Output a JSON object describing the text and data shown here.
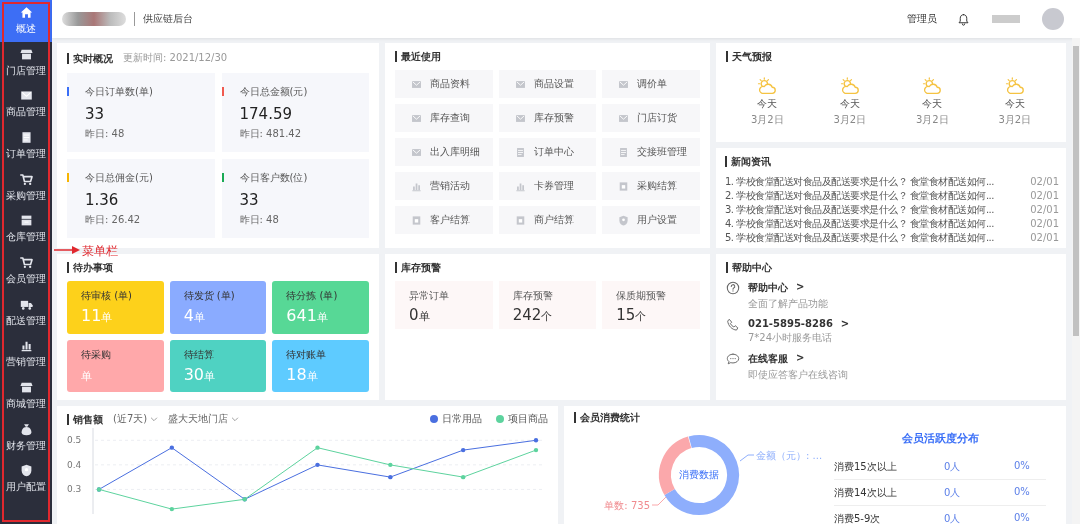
{
  "sidebar": {
    "items": [
      {
        "label": "概述",
        "kind": "home",
        "selected": true
      },
      {
        "label": "门店管理",
        "kind": "store",
        "selected": false
      },
      {
        "label": "商品管理",
        "kind": "tray",
        "selected": false
      },
      {
        "label": "订单管理",
        "kind": "note",
        "selected": false
      },
      {
        "label": "采购管理",
        "kind": "cart",
        "selected": false
      },
      {
        "label": "仓库管理",
        "kind": "archive",
        "selected": false
      },
      {
        "label": "会员管理",
        "kind": "cart",
        "selected": false
      },
      {
        "label": "配送管理",
        "kind": "truck",
        "selected": false
      },
      {
        "label": "营销管理",
        "kind": "bars",
        "selected": false
      },
      {
        "label": "商城管理",
        "kind": "store",
        "selected": false
      },
      {
        "label": "财务管理",
        "kind": "moneybag",
        "selected": false
      },
      {
        "label": "用户配置",
        "kind": "shield",
        "selected": false
      }
    ]
  },
  "annotation": {
    "label": "菜单栏"
  },
  "header": {
    "title": "供应链后台",
    "user_role": "管理员"
  },
  "overview": {
    "title": "实时概况",
    "updated": "更新时间: 2021/12/30",
    "stats": [
      {
        "label": "今日订单数(单)",
        "value": "33",
        "yesterday": "昨日: 48",
        "color": "#3a6ff7"
      },
      {
        "label": "今日总金额(元)",
        "value": "174.59",
        "yesterday": "昨日: 481.42",
        "color": "#f05a4f"
      },
      {
        "label": "今日总佣金(元)",
        "value": "1.36",
        "yesterday": "昨日: 26.42",
        "color": "#f7b500"
      },
      {
        "label": "今日客户数(位)",
        "value": "33",
        "yesterday": "昨日: 48",
        "color": "#1aaa55"
      }
    ]
  },
  "recent": {
    "title": "最近使用",
    "items": [
      {
        "label": "商品资料",
        "kind": "tray"
      },
      {
        "label": "商品设置",
        "kind": "tray"
      },
      {
        "label": "调价单",
        "kind": "tray"
      },
      {
        "label": "库存查询",
        "kind": "tray"
      },
      {
        "label": "库存预警",
        "kind": "tray"
      },
      {
        "label": "门店订货",
        "kind": "tray"
      },
      {
        "label": "出入库明细",
        "kind": "tray"
      },
      {
        "label": "订单中心",
        "kind": "note"
      },
      {
        "label": "交接班管理",
        "kind": "note"
      },
      {
        "label": "营销活动",
        "kind": "bars"
      },
      {
        "label": "卡券管理",
        "kind": "bars"
      },
      {
        "label": "采购结算",
        "kind": "bill"
      },
      {
        "label": "客户结算",
        "kind": "bill"
      },
      {
        "label": "商户结算",
        "kind": "bill"
      },
      {
        "label": "用户设置",
        "kind": "shield"
      }
    ]
  },
  "weather": {
    "title": "天气预报",
    "days": [
      {
        "day": "今天",
        "date": "3月2日"
      },
      {
        "day": "今天",
        "date": "3月2日"
      },
      {
        "day": "今天",
        "date": "3月2日"
      },
      {
        "day": "今天",
        "date": "3月2日"
      }
    ]
  },
  "news": {
    "title": "新闻资讯",
    "items": [
      {
        "text": "1. 学校食堂配送对食品及配送要求是什么？ 食堂食材配送如何...",
        "date": "02/01"
      },
      {
        "text": "2. 学校食堂配送对食品及配送要求是什么？ 食堂食材配送如何...",
        "date": "02/01"
      },
      {
        "text": "3. 学校食堂配送对食品及配送要求是什么？ 食堂食材配送如何...",
        "date": "02/01"
      },
      {
        "text": "4. 学校食堂配送对食品及配送要求是什么？ 食堂食材配送如何...",
        "date": "02/01"
      },
      {
        "text": "5. 学校食堂配送对食品及配送要求是什么？ 食堂食材配送如何...",
        "date": "02/01"
      }
    ]
  },
  "todo": {
    "title": "待办事项",
    "cards": [
      {
        "label": "待审核 (单)",
        "value": "11",
        "unit": "单",
        "color": "#fdd11b"
      },
      {
        "label": "待发货 (单)",
        "value": "4",
        "unit": "单",
        "color": "#8aabff"
      },
      {
        "label": "待分拣 (单)",
        "value": "641",
        "unit": "单",
        "color": "#57d896"
      },
      {
        "label": "待采购",
        "unit": "单",
        "color": "#ffa8aa"
      },
      {
        "label": "待结算",
        "value": "30",
        "unit": "单",
        "color": "#4fd2c2"
      },
      {
        "label": "待对账单",
        "value": "18",
        "unit": "单",
        "color": "#5ecbff"
      }
    ]
  },
  "stock": {
    "title": "库存预警",
    "items": [
      {
        "label": "异常订单",
        "value": "0",
        "unit": "单"
      },
      {
        "label": "库存预警",
        "value": "242",
        "unit": "个"
      },
      {
        "label": "保质期预警",
        "value": "15",
        "unit": "个"
      }
    ]
  },
  "help": {
    "title": "帮助中心",
    "items": [
      {
        "kind": "question",
        "title": "帮助中心",
        "chevron": ">",
        "desc": "全面了解产品功能"
      },
      {
        "kind": "phone",
        "title": "021-5895-8286",
        "chevron": ">",
        "desc": "7*24小时服务电话"
      },
      {
        "kind": "chat",
        "title": "在线客服",
        "chevron": ">",
        "desc": "即使应答客户在线咨询"
      }
    ]
  },
  "sales": {
    "title": "销售额",
    "range": "(近7天)",
    "store": "盛大天地门店",
    "chart_data": {
      "type": "line",
      "grid": true,
      "ylim": [
        0.2,
        0.55
      ],
      "yticks": [
        0.3,
        0.4,
        0.5
      ],
      "series": [
        {
          "name": "日常用品",
          "color": "#4a6fe0",
          "values": [
            0.3,
            0.47,
            0.26,
            0.4,
            0.35,
            0.46,
            0.5
          ]
        },
        {
          "name": "项目商品",
          "color": "#5dd39e",
          "values": [
            0.3,
            0.22,
            0.26,
            0.47,
            0.4,
            0.35,
            0.46
          ]
        }
      ]
    }
  },
  "member": {
    "title": "会员消费统计",
    "donut_center": "消费数据",
    "amount_label": "金额（元）: ...",
    "orders_label": "单数: 735",
    "table_title": "会员活跃度分布",
    "rows": [
      {
        "label": "消费15次以上",
        "count": "0人",
        "share": "0%"
      },
      {
        "label": "消费14次以上",
        "count": "0人",
        "share": "0%"
      },
      {
        "label": "消费5-9次",
        "count": "0人",
        "share": "0%"
      }
    ]
  }
}
